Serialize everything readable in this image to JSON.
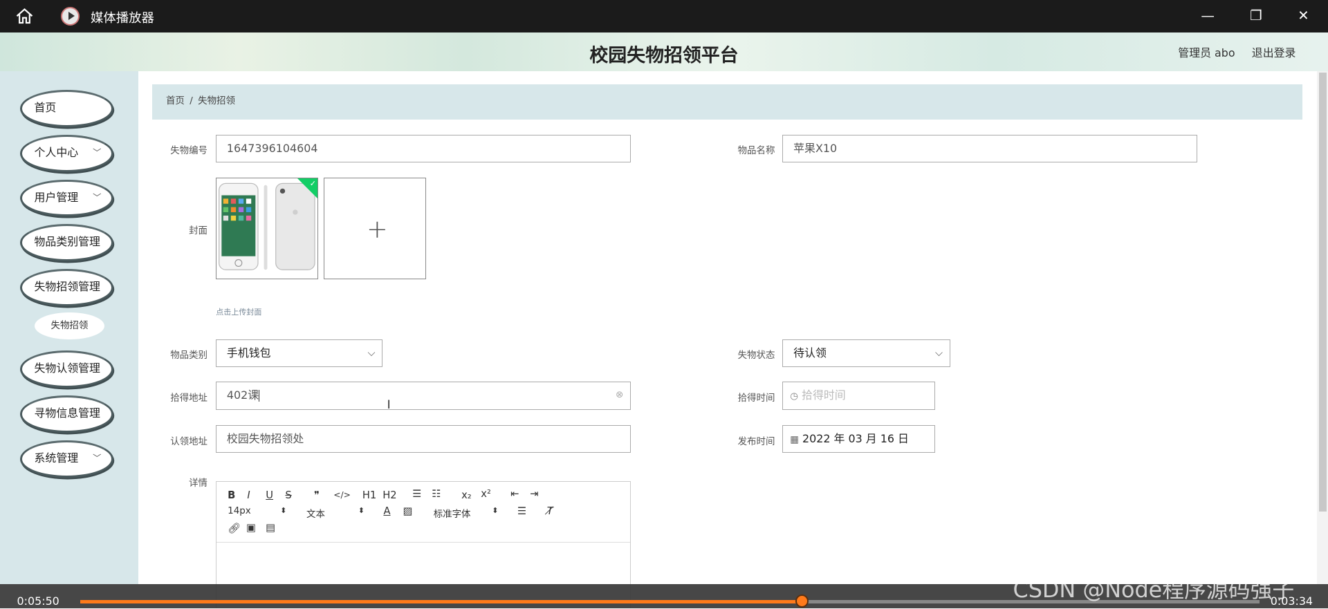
{
  "window": {
    "title": "媒体播放器"
  },
  "header": {
    "title": "校园失物招领平台",
    "user": "管理员 abo",
    "logout": "退出登录"
  },
  "sidebar": {
    "items": [
      {
        "label": "首页",
        "has_chevron": false
      },
      {
        "label": "个人中心",
        "has_chevron": true
      },
      {
        "label": "用户管理",
        "has_chevron": true
      },
      {
        "label": "物品类别管理",
        "has_chevron": false
      },
      {
        "label": "失物招领管理",
        "has_chevron": false
      },
      {
        "label": "失物认领管理",
        "has_chevron": false
      },
      {
        "label": "寻物信息管理",
        "has_chevron": false
      },
      {
        "label": "系统管理",
        "has_chevron": true
      }
    ],
    "subitem": {
      "label": "失物招领"
    }
  },
  "breadcrumb": {
    "home": "首页",
    "separator": "/",
    "current": "失物招领"
  },
  "form": {
    "lost_no": {
      "label": "失物编号",
      "value": "1647396104604"
    },
    "item_name": {
      "label": "物品名称",
      "value": "苹果X10"
    },
    "cover": {
      "label": "封面",
      "hint": "点击上传封面"
    },
    "category": {
      "label": "物品类别",
      "value": "手机钱包"
    },
    "status": {
      "label": "失物状态",
      "value": "待认领"
    },
    "found_address": {
      "label": "拾得地址",
      "value": "402课"
    },
    "found_time": {
      "label": "拾得时间",
      "placeholder": "拾得时间"
    },
    "claim_address": {
      "label": "认领地址",
      "value": "校园失物招领处"
    },
    "publish_time": {
      "label": "发布时间",
      "value": "2022 年 03 月 16 日"
    },
    "details": {
      "label": "详情"
    }
  },
  "editor_toolbar": {
    "bold": "B",
    "italic": "I",
    "underline": "U",
    "strike": "S",
    "quote": "❞",
    "code": "</>",
    "h1": "H1",
    "h2": "H2",
    "font_size": "14px",
    "text_type": "文本",
    "font_family": "标准字体"
  },
  "video": {
    "elapsed": "0:05:50",
    "remaining": "0:03:34",
    "progress": 0.612
  },
  "watermark": "CSDN @Node程序源码强子"
}
